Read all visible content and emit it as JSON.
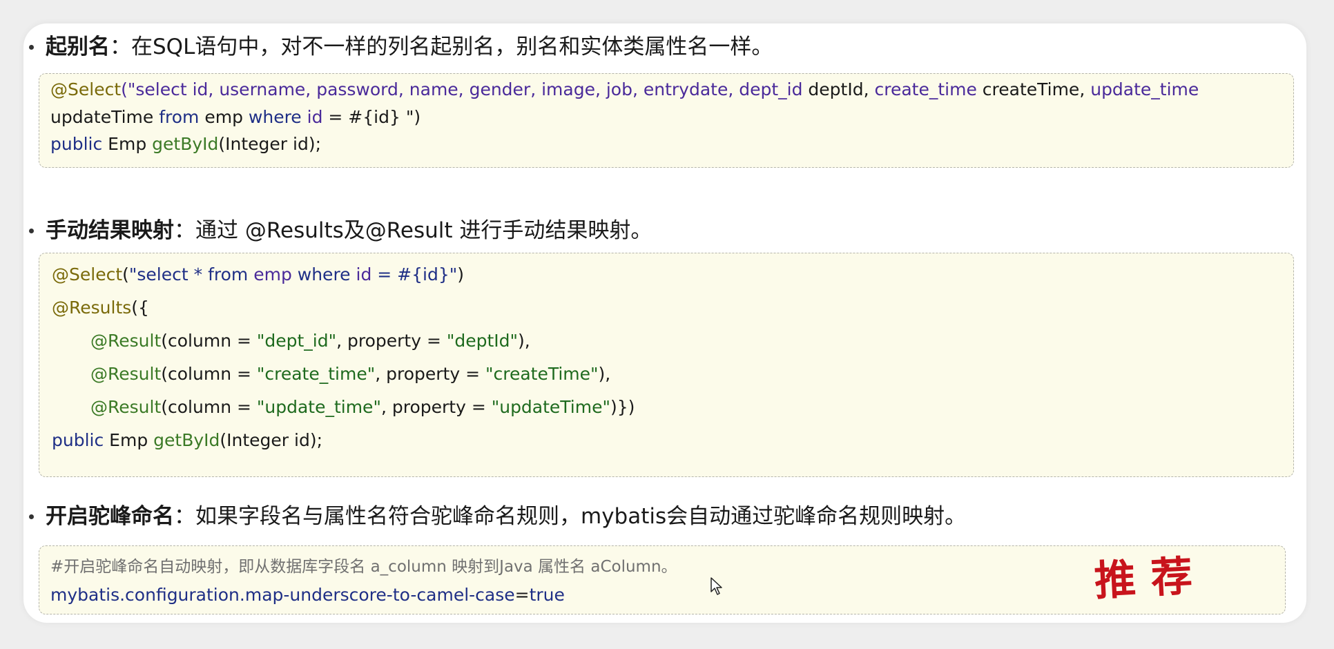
{
  "section1": {
    "title": "起别名",
    "text": "：在SQL语句中，对不一样的列名起别名，别名和实体类属性名一样。",
    "code": {
      "l1_ann": "@Select",
      "l1_str": "(\"select id, username, password, name, gender, image, job, entrydate, dept_id",
      "l1_plain": " deptId, ",
      "l1_str2": "create_time",
      "l1_plain2": " createTime, ",
      "l1_str3": "update_time",
      "l2_plain": "updateTime ",
      "l2_kw": "from",
      "l2_plain2": " emp ",
      "l2_kw2": "where",
      "l2_str": " id",
      "l2_plain3": " = #{id} \")",
      "l3_kw": "public",
      "l3_plain": " Emp ",
      "l3_ann": "getById",
      "l3_plain2": "(Integer id);"
    }
  },
  "section2": {
    "title": "手动结果映射",
    "text": "：通过 @Results及@Result 进行手动结果映射。",
    "code": {
      "l1_ann": "@Select",
      "l1_p": "(",
      "l1_s1": "\"select * ",
      "l1_kw1": "from",
      "l1_s2": " emp ",
      "l1_kw2": "where",
      "l1_s3": " id",
      "l1_s4": " = #{id}\"",
      "l1_end": ")",
      "l2_ann": "@Results",
      "l2_p": "({",
      "r1_ann": "@Result",
      "r1_a": "(column = ",
      "r1_v1": "\"dept_id\"",
      "r1_b": ", property = ",
      "r1_v2": "\"deptId\"",
      "r1_c": "),",
      "r2_ann": "@Result",
      "r2_a": "(column = ",
      "r2_v1": "\"create_time\"",
      "r2_b": ", property = ",
      "r2_v2": "\"createTime\"",
      "r2_c": "),",
      "r3_ann": "@Result",
      "r3_a": "(column = ",
      "r3_v1": "\"update_time\"",
      "r3_b": ", property = ",
      "r3_v2": "\"updateTime\"",
      "r3_c": ")})",
      "l6_kw": "public",
      "l6_plain": " Emp ",
      "l6_ann": "getById",
      "l6_plain2": "(Integer id);"
    }
  },
  "section3": {
    "title": "开启驼峰命名",
    "text": "：如果字段名与属性名符合驼峰命名规则，mybatis会自动通过驼峰命名规则映射。",
    "code": {
      "comment": "#开启驼峰命名自动映射，即从数据库字段名 a_column 映射到Java 属性名 aColumn。",
      "config_key": "mybatis.configuration.map-underscore-to-camel-case",
      "config_eq": "=",
      "config_val": "true"
    },
    "stamp": "推荐"
  },
  "colors": {
    "annotation": "#7a6a0a",
    "result_annotation": "#3b7a26",
    "sql_string": "#4a2a9a",
    "keyword": "#1f2f86",
    "string_value": "#1e6a1e",
    "code_background": "#fcfbea",
    "stamp": "#c8141c"
  }
}
